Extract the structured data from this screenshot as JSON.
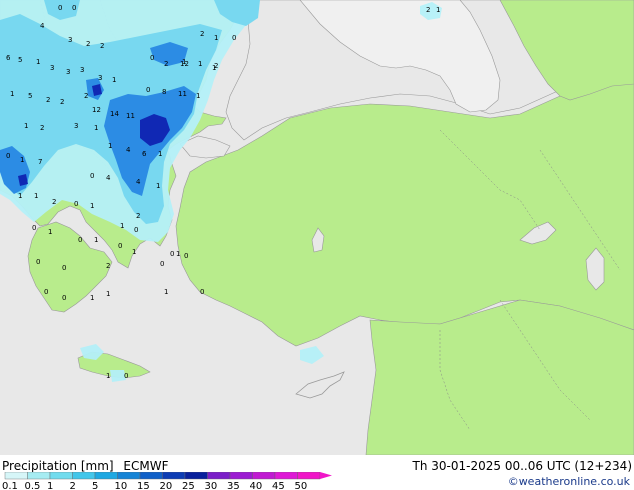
{
  "legend": {
    "title": "Precipitation [mm]",
    "model": "ECMWF",
    "valid_time": "Th 30-01-2025 00..06 UTC (12+234)",
    "credit": "©weatheronline.co.uk",
    "levels": [
      "0.1",
      "0.5",
      "1",
      "2",
      "5",
      "10",
      "15",
      "20",
      "25",
      "30",
      "35",
      "40",
      "45",
      "50"
    ],
    "colors": [
      "#d6f6f8",
      "#a6ecf2",
      "#72dcee",
      "#42c6ea",
      "#1ea8e2",
      "#1684d6",
      "#1160c8",
      "#0c3cb4",
      "#08209c",
      "#7a1ec8",
      "#9c1cd2",
      "#c01ad2",
      "#de18d6",
      "#f016c8"
    ]
  },
  "colors": {
    "sea": "#e8e8e8",
    "land_forecast": "#b8ec8c",
    "land_outside": "#f0f0f0",
    "precip_light": "#b4f0f8",
    "precip_moderate": "#78d8f0",
    "precip_heavy": "#2c8ce4",
    "precip_extreme": "#1028b4"
  },
  "station_values": [
    "0",
    "0",
    "4",
    "3",
    "2",
    "2",
    "6",
    "5",
    "1",
    "3",
    "3",
    "3",
    "3",
    "2",
    "1",
    "0",
    "1",
    "1",
    "2",
    "2",
    "1",
    "0",
    "12",
    "2",
    "1",
    "0",
    "8",
    "11",
    "1",
    "1",
    "5",
    "2",
    "2",
    "12",
    "14",
    "11",
    "1",
    "2",
    "3",
    "1",
    "1",
    "4",
    "6",
    "1",
    "0",
    "1",
    "7",
    "1",
    "4",
    "0",
    "4",
    "2",
    "1",
    "0",
    "2",
    "1",
    "1",
    "0",
    "1",
    "0",
    "1",
    "0",
    "0",
    "0",
    "0",
    "0",
    "1",
    "1",
    "2",
    "1",
    "0",
    "1",
    "0",
    "1",
    "0",
    "1",
    "1",
    "2",
    "1",
    "0",
    "0",
    "0"
  ]
}
